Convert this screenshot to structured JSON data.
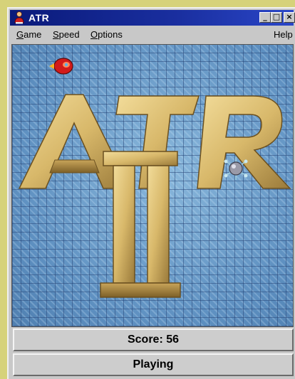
{
  "window": {
    "title": "ATR",
    "icon": "app-person-icon",
    "controls": {
      "minimize": "_",
      "maximize": "□",
      "close": "×"
    }
  },
  "menu": {
    "game": {
      "hotkey": "G",
      "rest": "ame"
    },
    "speed": {
      "hotkey": "S",
      "rest": "peed"
    },
    "options": {
      "hotkey": "O",
      "rest": "ptions"
    },
    "help": {
      "hotkey": "",
      "rest": "Help"
    }
  },
  "game": {
    "logo_word": "ATR",
    "logo_numeral": "II",
    "player_ship": "red-rocket-ship",
    "enemy": "spiked-mine",
    "colors": {
      "logo": "#d8b86a",
      "background": "#6a9cc8"
    }
  },
  "score": {
    "text": "Score: 56",
    "value": 56
  },
  "status": {
    "text": "Playing"
  }
}
